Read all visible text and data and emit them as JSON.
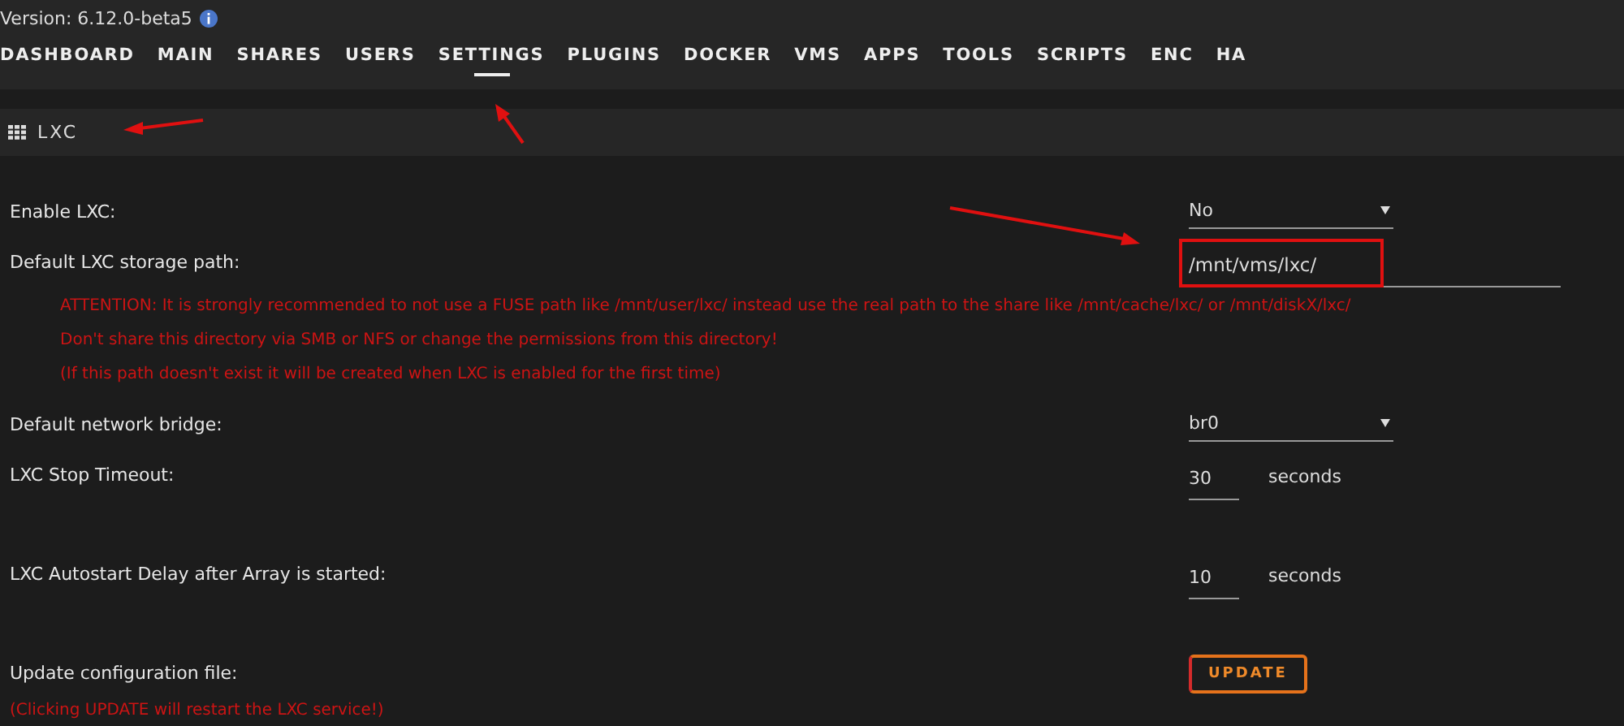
{
  "header": {
    "version": "Version: 6.12.0-beta5"
  },
  "tabs": [
    {
      "label": "DASHBOARD",
      "selected": false
    },
    {
      "label": "MAIN",
      "selected": false
    },
    {
      "label": "SHARES",
      "selected": false
    },
    {
      "label": "USERS",
      "selected": false
    },
    {
      "label": "SETTINGS",
      "selected": true
    },
    {
      "label": "PLUGINS",
      "selected": false
    },
    {
      "label": "DOCKER",
      "selected": false
    },
    {
      "label": "VMS",
      "selected": false
    },
    {
      "label": "APPS",
      "selected": false
    },
    {
      "label": "TOOLS",
      "selected": false
    },
    {
      "label": "SCRIPTS",
      "selected": false
    },
    {
      "label": "ENC",
      "selected": false
    },
    {
      "label": "HA",
      "selected": false
    }
  ],
  "section": {
    "title": "LXC"
  },
  "settings": [
    {
      "kind": "select",
      "label": "Enable LXC:",
      "value": "No"
    },
    {
      "kind": "text",
      "label": "Default LXC storage path:",
      "value": "/mnt/vms/lxc/",
      "notes": [
        "ATTENTION: It is strongly recommended to not use a FUSE path like /mnt/user/lxc/ instead use the real path to the share like /mnt/cache/lxc/ or /mnt/diskX/lxc/",
        "Don't share this directory via SMB or NFS or change the permissions from this directory!",
        "(If this path doesn't exist it will be created when LXC is enabled for the first time)"
      ]
    },
    {
      "kind": "select",
      "label": "Default network bridge:",
      "value": "br0"
    },
    {
      "kind": "number",
      "label": "LXC Stop Timeout:",
      "value": "30",
      "unit": "seconds"
    },
    {
      "kind": "number",
      "label": "LXC Autostart Delay after Array is started:",
      "value": "10",
      "unit": "seconds"
    },
    {
      "kind": "button",
      "label": "Update configuration file:",
      "value": "UPDATE",
      "notes": [
        "(Clicking UPDATE will restart the LXC service!)"
      ]
    }
  ]
}
